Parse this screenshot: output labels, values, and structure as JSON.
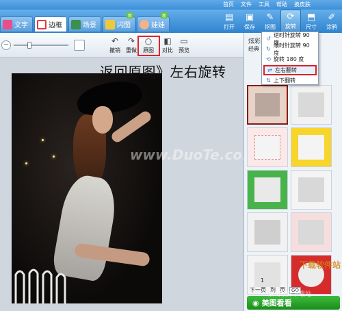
{
  "top_menu": [
    "首页",
    "文件",
    "工具",
    "帮助",
    "换皮肤"
  ],
  "tabs": [
    {
      "label": "文字",
      "icon": "text-icon"
    },
    {
      "label": "边框",
      "icon": "frame-icon",
      "active": true
    },
    {
      "label": "场景",
      "icon": "scene-icon"
    },
    {
      "label": "闪图",
      "icon": "flash-icon",
      "badge": "新"
    },
    {
      "label": "娃娃",
      "icon": "doll-icon",
      "badge": "新"
    }
  ],
  "tools": [
    {
      "label": "打开",
      "icon": "open-icon"
    },
    {
      "label": "保存",
      "icon": "save-icon"
    },
    {
      "label": "抠图",
      "icon": "cutout-icon"
    },
    {
      "label": "旋转",
      "icon": "rotate-icon",
      "active": true
    },
    {
      "label": "尺寸",
      "icon": "resize-icon"
    },
    {
      "label": "涂鸦",
      "icon": "doodle-icon"
    }
  ],
  "toolbar2": {
    "undo": "撤销",
    "redo": "重做",
    "original": "原图",
    "compare": "对比",
    "preview": "预览"
  },
  "callout": "返回原图》左右旋转",
  "watermark": "www.DuoTe.com",
  "rotate_menu": [
    {
      "label": "逆时针旋转 90 度",
      "icon": "rotate-ccw-icon"
    },
    {
      "label": "顺时针旋转 90 度",
      "icon": "rotate-cw-icon"
    },
    {
      "label": "旋转 180 度",
      "icon": "rotate-180-icon"
    },
    {
      "label": "左右翻转",
      "icon": "flip-horizontal-icon",
      "highlighted": true
    },
    {
      "label": "上下翻转",
      "icon": "flip-vertical-icon"
    }
  ],
  "right_panel": {
    "title": "炫彩",
    "sub": "经典",
    "pager": {
      "page": "1",
      "next": "下一页",
      "to": "到",
      "page_label": "页",
      "go": "GO"
    },
    "meitu_button": "美图看看"
  },
  "corner_logo": {
    "line1": "下载软件站",
    "line2": "点击软件下载站"
  },
  "colors": {
    "accent": "#3d8fd8",
    "highlight_red": "#e0232b",
    "meitu_green": "#2aa52a"
  }
}
